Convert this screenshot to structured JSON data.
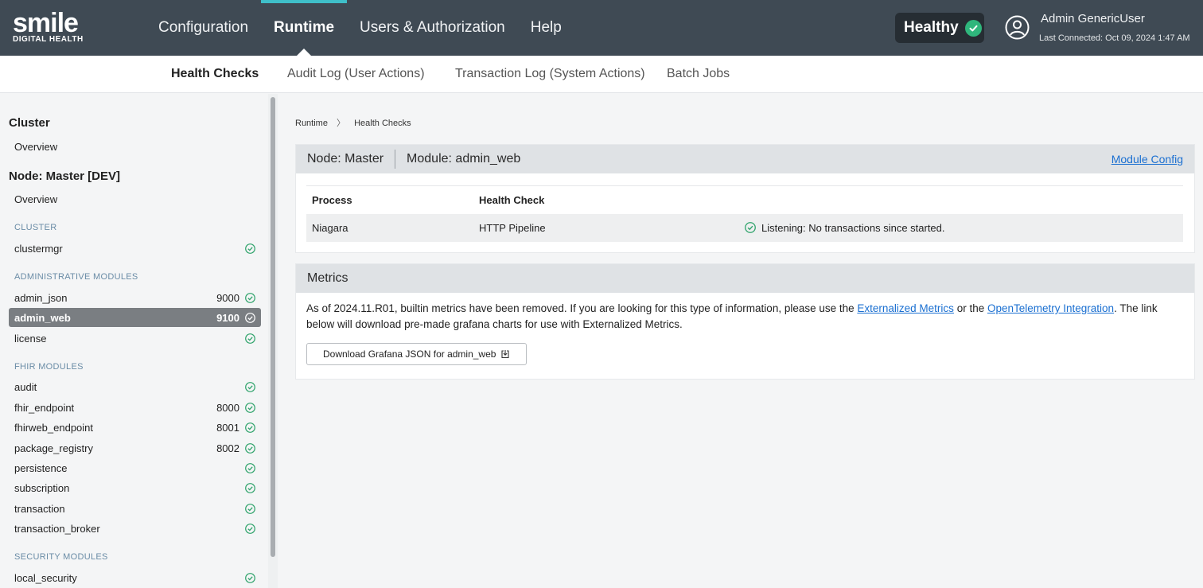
{
  "header": {
    "logo_text": "smile",
    "logo_sub": "DIGITAL HEALTH",
    "nav": [
      {
        "label": "Configuration"
      },
      {
        "label": "Runtime"
      },
      {
        "label": "Users & Authorization"
      },
      {
        "label": "Help"
      }
    ],
    "active_nav": "Runtime",
    "health_status": "Healthy",
    "user_name": "Admin GenericUser",
    "last_connected": "Last Connected: Oct 09, 2024 1:47 AM"
  },
  "subnav": {
    "tabs": [
      {
        "label": "Health Checks"
      },
      {
        "label": "Audit Log (User Actions)"
      },
      {
        "label": "Transaction Log (System Actions)"
      },
      {
        "label": "Batch Jobs"
      }
    ],
    "active_tab": "Health Checks"
  },
  "sidebar": {
    "cluster_heading": "Cluster",
    "cluster_overview": "Overview",
    "node_heading": "Node: Master [DEV]",
    "node_overview": "Overview",
    "sections": [
      {
        "title": "CLUSTER",
        "items": [
          {
            "name": "clustermgr",
            "port": "",
            "status": "ok"
          }
        ]
      },
      {
        "title": "ADMINISTRATIVE MODULES",
        "items": [
          {
            "name": "admin_json",
            "port": "9000",
            "status": "ok"
          },
          {
            "name": "admin_web",
            "port": "9100",
            "status": "ok",
            "selected": true
          },
          {
            "name": "license",
            "port": "",
            "status": "ok"
          }
        ]
      },
      {
        "title": "FHIR MODULES",
        "items": [
          {
            "name": "audit",
            "port": "",
            "status": "ok"
          },
          {
            "name": "fhir_endpoint",
            "port": "8000",
            "status": "ok"
          },
          {
            "name": "fhirweb_endpoint",
            "port": "8001",
            "status": "ok"
          },
          {
            "name": "package_registry",
            "port": "8002",
            "status": "ok"
          },
          {
            "name": "persistence",
            "port": "",
            "status": "ok"
          },
          {
            "name": "subscription",
            "port": "",
            "status": "ok"
          },
          {
            "name": "transaction",
            "port": "",
            "status": "ok"
          },
          {
            "name": "transaction_broker",
            "port": "",
            "status": "ok"
          }
        ]
      },
      {
        "title": "SECURITY MODULES",
        "items": [
          {
            "name": "local_security",
            "port": "",
            "status": "ok"
          }
        ]
      }
    ]
  },
  "breadcrumb": [
    "Runtime",
    "Health Checks"
  ],
  "module_card": {
    "node_label": "Node: Master",
    "module_label": "Module: admin_web",
    "config_link": "Module Config",
    "table": {
      "headers": [
        "Process",
        "Health Check",
        ""
      ],
      "rows": [
        {
          "process": "Niagara",
          "check": "HTTP Pipeline",
          "status": "Listening: No transactions since started."
        }
      ]
    }
  },
  "metrics": {
    "title": "Metrics",
    "text_before": "As of 2024.11.R01, builtin metrics have been removed. If you are looking for this type of information, please use the ",
    "link1": "Externalized Metrics",
    "text_mid": " or the ",
    "link2": "OpenTelemetry Integration",
    "text_after": ". The link below will download pre-made grafana charts for use with Externalized Metrics.",
    "download_label": "Download Grafana JSON for admin_web"
  },
  "colors": {
    "topbar": "#3f4a54",
    "accent": "#3fbfc9",
    "healthy_green": "#2fb67c",
    "link_blue": "#1a6fd1",
    "selected_row": "#7a7e82"
  }
}
